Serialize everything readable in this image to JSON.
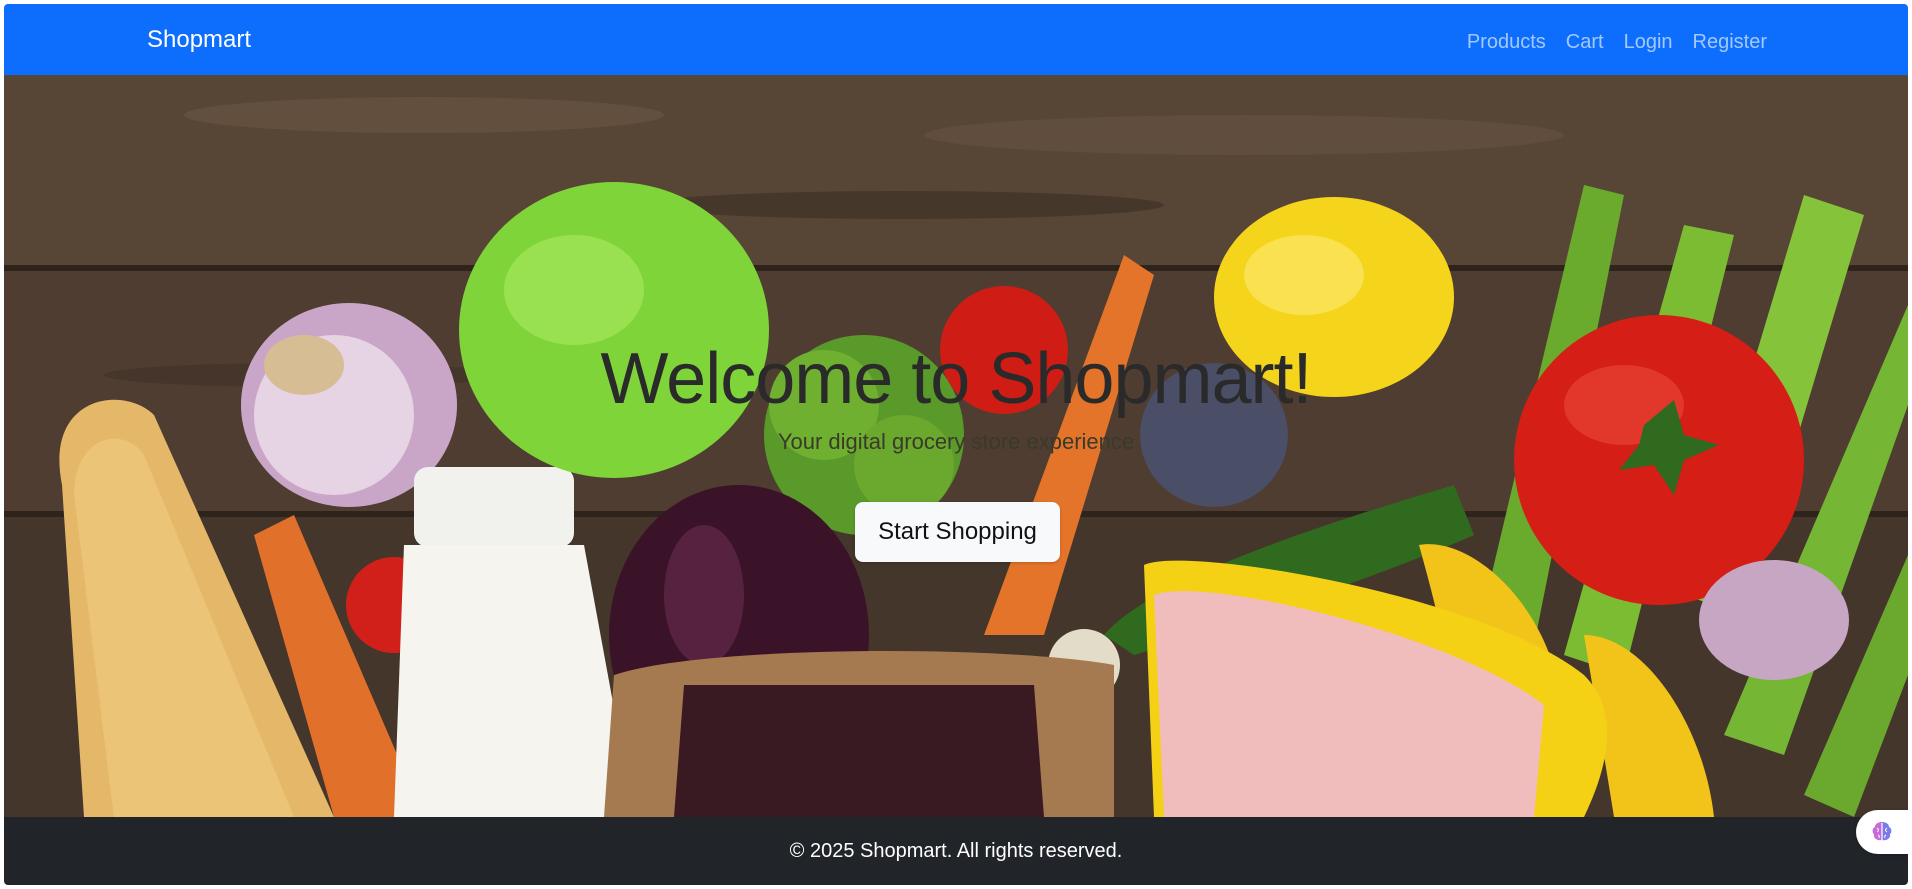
{
  "navbar": {
    "brand": "Shopmart",
    "links": [
      {
        "label": "Products"
      },
      {
        "label": "Cart"
      },
      {
        "label": "Login"
      },
      {
        "label": "Register"
      }
    ],
    "background_color": "#0d6efd"
  },
  "hero": {
    "title": "Welcome to Shopmart!",
    "subtitle": "Your digital grocery store experience",
    "cta_label": "Start Shopping",
    "background": "groceries-on-wooden-table-photo"
  },
  "footer": {
    "text": "© 2025 Shopmart. All rights reserved.",
    "background_color": "#212529"
  },
  "floating_widget": {
    "icon": "brain-icon"
  }
}
